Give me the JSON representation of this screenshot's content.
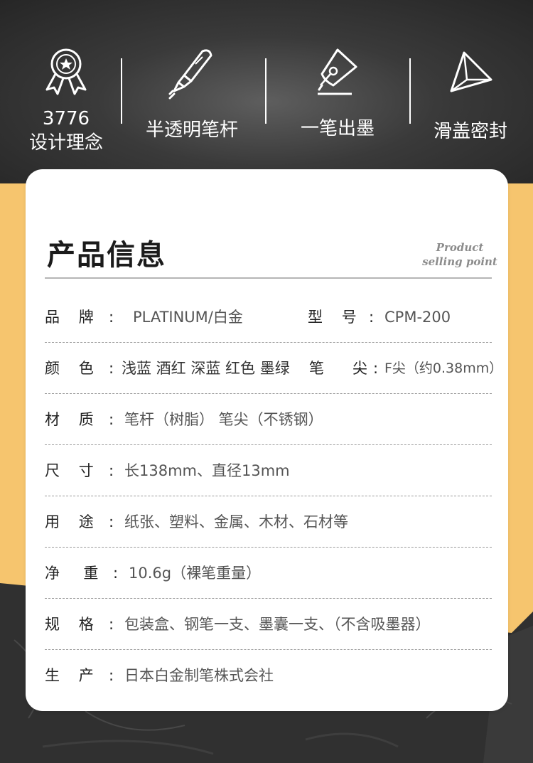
{
  "features": [
    {
      "line1": "3776",
      "line2": "设计理念",
      "icon": "award-ribbon-icon"
    },
    {
      "label": "半透明笔杆",
      "icon": "fountain-pen-icon"
    },
    {
      "label": "一笔出墨",
      "icon": "pen-nib-icon"
    },
    {
      "label": "滑盖密封",
      "icon": "triangle-cap-icon"
    }
  ],
  "card": {
    "title": "产品信息",
    "script_line1": "Product",
    "script_line2": "selling point",
    "rows": [
      {
        "label": "品    牌",
        "value": "PLATINUM/白金",
        "label2": "型    号",
        "value2": "CPM-200"
      },
      {
        "label": "颜    色",
        "value": "浅蓝 酒红 深蓝 红色 墨绿",
        "label2": "笔      尖",
        "value2": "F尖（约0.38mm）"
      },
      {
        "label": "材    质",
        "value": "笔杆（树脂） 笔尖（不锈钢）"
      },
      {
        "label": "尺    寸",
        "value": "长138mm、直径13mm"
      },
      {
        "label": "用    途",
        "value": "纸张、塑料、金属、木材、石材等"
      },
      {
        "label": "净     重",
        "value": "10.6g（裸笔重量）"
      },
      {
        "label": "规    格",
        "value": "包装盒、钢笔一支、墨囊一支、（不含吸墨器）"
      },
      {
        "label": "生    产",
        "value": "日本白金制笔株式会社"
      }
    ]
  },
  "colors": {
    "yellow": "#f6c56e",
    "dark": "#2b2b2b",
    "card": "#ffffff"
  }
}
